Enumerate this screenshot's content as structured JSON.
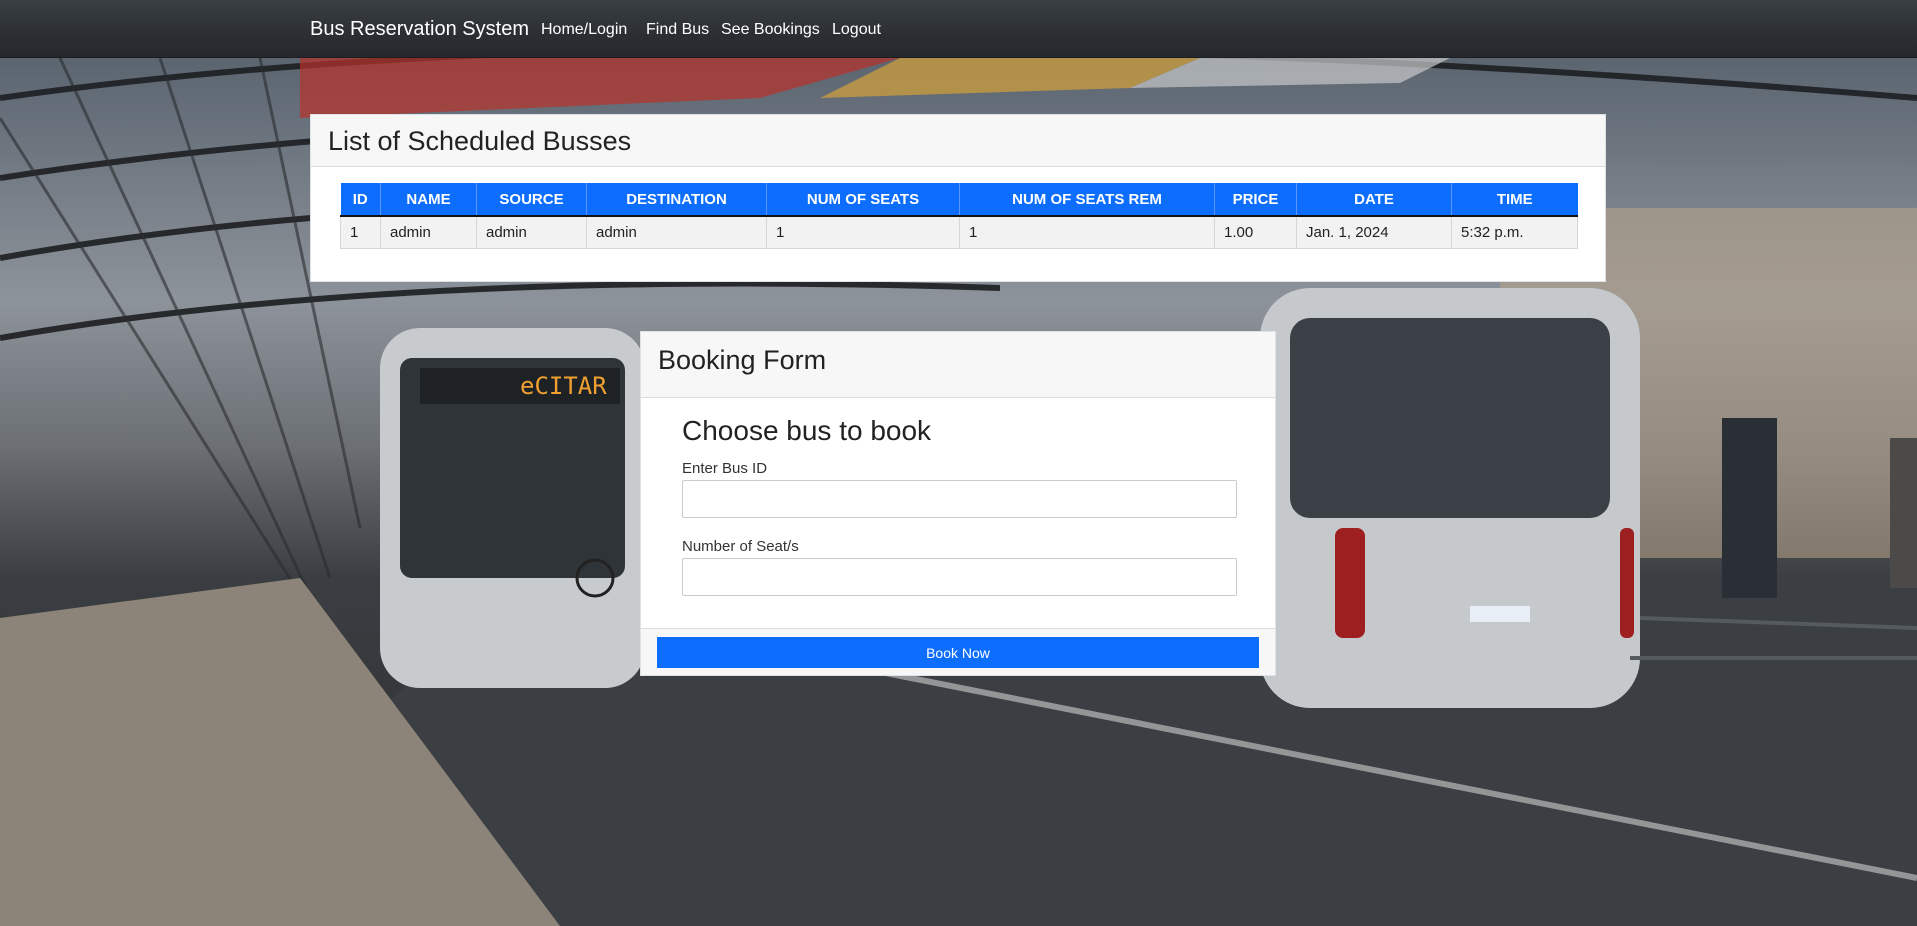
{
  "navbar": {
    "brand": "Bus Reservation System",
    "links": [
      "Home/Login",
      "Find Bus",
      "See Bookings",
      "Logout"
    ]
  },
  "busList": {
    "title": "List of Scheduled Busses",
    "columns": [
      "ID",
      "NAME",
      "SOURCE",
      "DESTINATION",
      "NUM OF SEATS",
      "NUM OF SEATS REM",
      "PRICE",
      "DATE",
      "TIME"
    ],
    "rows": [
      [
        "1",
        "admin",
        "admin",
        "admin",
        "1",
        "1",
        "1.00",
        "Jan. 1, 2024",
        "5:32 p.m."
      ]
    ]
  },
  "booking": {
    "title": "Booking Form",
    "subtitle": "Choose bus to book",
    "busIdLabel": "Enter Bus ID",
    "busIdValue": "",
    "seatsLabel": "Number of Seat/s",
    "seatsValue": "",
    "submitLabel": "Book Now"
  },
  "colors": {
    "primary": "#0d6efd",
    "navbar": "#2b2f33"
  }
}
